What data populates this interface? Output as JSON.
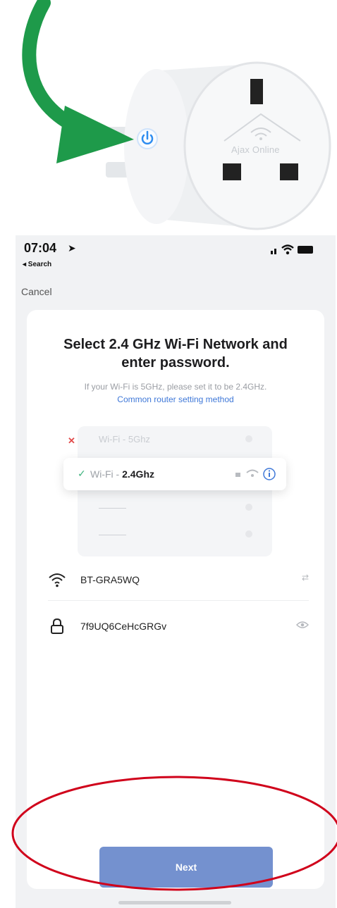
{
  "product": {
    "brand_watermark": "Ajax Online"
  },
  "status_bar": {
    "time": "07:04",
    "location_glyph": "➤",
    "back_label": "◂ Search"
  },
  "nav": {
    "cancel_label": "Cancel"
  },
  "setup": {
    "title_line1": "Select 2.4 GHz Wi-Fi Network and",
    "title_line2": "enter password.",
    "subtitle": "If your Wi-Fi is 5GHz, please set it to be 2.4GHz.",
    "help_link": "Common router setting method",
    "illustration": {
      "row_5ghz": "Wi-Fi - 5Ghz",
      "row_24_prefix": "Wi-Fi - ",
      "row_24_strong": "2.4Ghz",
      "blurred_rows": [
        "———",
        "———"
      ]
    },
    "network_name": "BT-GRA5WQ",
    "network_switch_hint": "⇄",
    "password": "7f9UQ6CeHcGRGv",
    "next_label": "Next"
  },
  "icons": {
    "product": "smart-plug-icon",
    "annotation_arrow": "green-arrow-icon",
    "wifi": "wifi-icon",
    "lock": "lock-icon",
    "eye": "eye-icon",
    "signal": "signal-icon",
    "battery": "battery-icon"
  },
  "colors": {
    "accent_button": "#7491cf",
    "link": "#3f78d8",
    "annotation_ellipse": "#d0021b",
    "annotation_arrow": "#1e9a4a",
    "power_led": "#2d8cf0"
  }
}
